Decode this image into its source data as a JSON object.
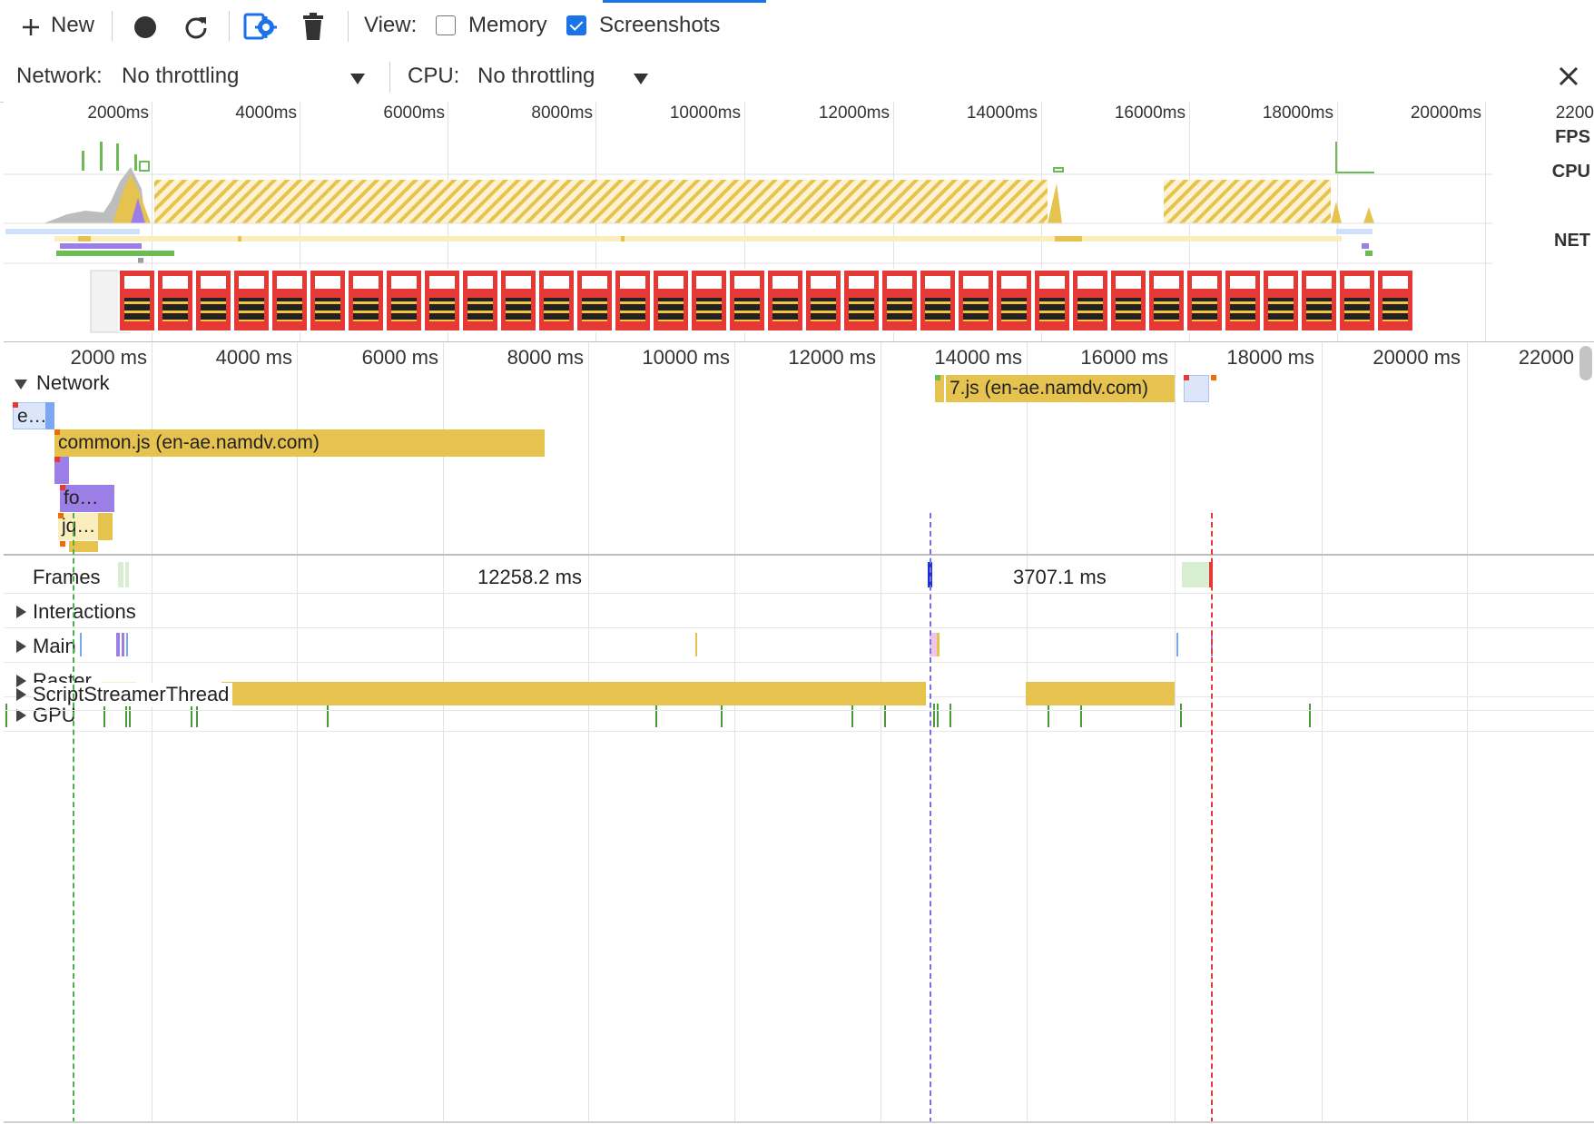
{
  "toolbar": {
    "new_label": "New",
    "view_label": "View:",
    "memory_label": "Memory",
    "memory_checked": false,
    "screenshots_label": "Screenshots",
    "screenshots_checked": true
  },
  "throttle": {
    "network_label": "Network:",
    "network_value": "No throttling",
    "cpu_label": "CPU:",
    "cpu_value": "No throttling"
  },
  "overview": {
    "ticks": [
      "2000ms",
      "4000ms",
      "6000ms",
      "8000ms",
      "10000ms",
      "12000ms",
      "14000ms",
      "16000ms",
      "18000ms",
      "20000ms",
      "2200"
    ],
    "labels": {
      "fps": "FPS",
      "cpu": "CPU",
      "net": "NET"
    }
  },
  "flamechart": {
    "ticks": [
      "2000 ms",
      "4000 ms",
      "6000 ms",
      "8000 ms",
      "10000 ms",
      "12000 ms",
      "14000 ms",
      "16000 ms",
      "18000 ms",
      "20000 ms",
      "22000"
    ],
    "network": {
      "label": "Network",
      "requests": {
        "e": "e…",
        "common": "common.js (en-ae.namdv.com)",
        "fo": "fo…",
        "jq": "jq…",
        "seven": "7.js (en-ae.namdv.com)"
      }
    },
    "tracks": {
      "frames": "Frames",
      "frame_duration_1": "12258.2 ms",
      "frame_duration_2": "3707.1 ms",
      "interactions": "Interactions",
      "main": "Main",
      "raster": "Raster",
      "gpu": "GPU",
      "script_streamer": "ScriptStreamerThread"
    }
  },
  "colors": {
    "accent": "#1a73e8",
    "scripting": "#e6c34f",
    "rendering": "#9b7fe6",
    "painting": "#6dbb54",
    "screenshot": "#e53935"
  },
  "icons": [
    "plus-icon",
    "record-icon",
    "reload-icon",
    "capture-settings-icon",
    "trash-icon",
    "close-icon"
  ]
}
